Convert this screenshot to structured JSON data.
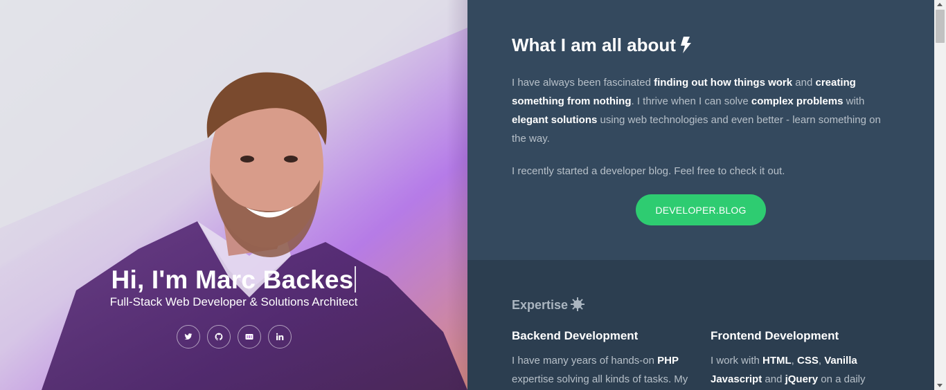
{
  "hero": {
    "greeting": "Hi, I'm Marc Backes",
    "subtitle": "Full-Stack Web Developer & Solutions Architect",
    "socials": [
      {
        "icon": "twitter-icon"
      },
      {
        "icon": "github-icon"
      },
      {
        "icon": "dev-icon"
      },
      {
        "icon": "linkedin-icon"
      }
    ]
  },
  "about": {
    "title": "What I am all about",
    "p1_a": "I have always been fascinated ",
    "p1_b": "finding out how things work",
    "p1_c": " and ",
    "p1_d": "creating something from nothing",
    "p1_e": ". I thrive when I can solve ",
    "p1_f": "complex problems",
    "p1_g": " with ",
    "p1_h": "elegant solutions",
    "p1_i": " using web technologies and even better - learn something on the way.",
    "p2": "I recently started a developer blog. Feel free to check it out.",
    "button": "DEVELOPER.BLOG"
  },
  "expertise": {
    "title": "Expertise",
    "backend": {
      "title": "Backend Development",
      "t1": "I have many years of hands-on ",
      "t2": "PHP",
      "t3": " expertise solving all kinds of tasks. My"
    },
    "frontend": {
      "title": "Frontend Development",
      "t1": "I work with ",
      "t2": "HTML",
      "t3": ", ",
      "t4": "CSS",
      "t5": ", ",
      "t6": "Vanilla Javascript",
      "t7": " and ",
      "t8": "jQuery",
      "t9": " on a daily"
    }
  },
  "colors": {
    "about_bg": "#34495e",
    "expertise_bg": "#2c3e50",
    "button_bg": "#2ecc71"
  }
}
